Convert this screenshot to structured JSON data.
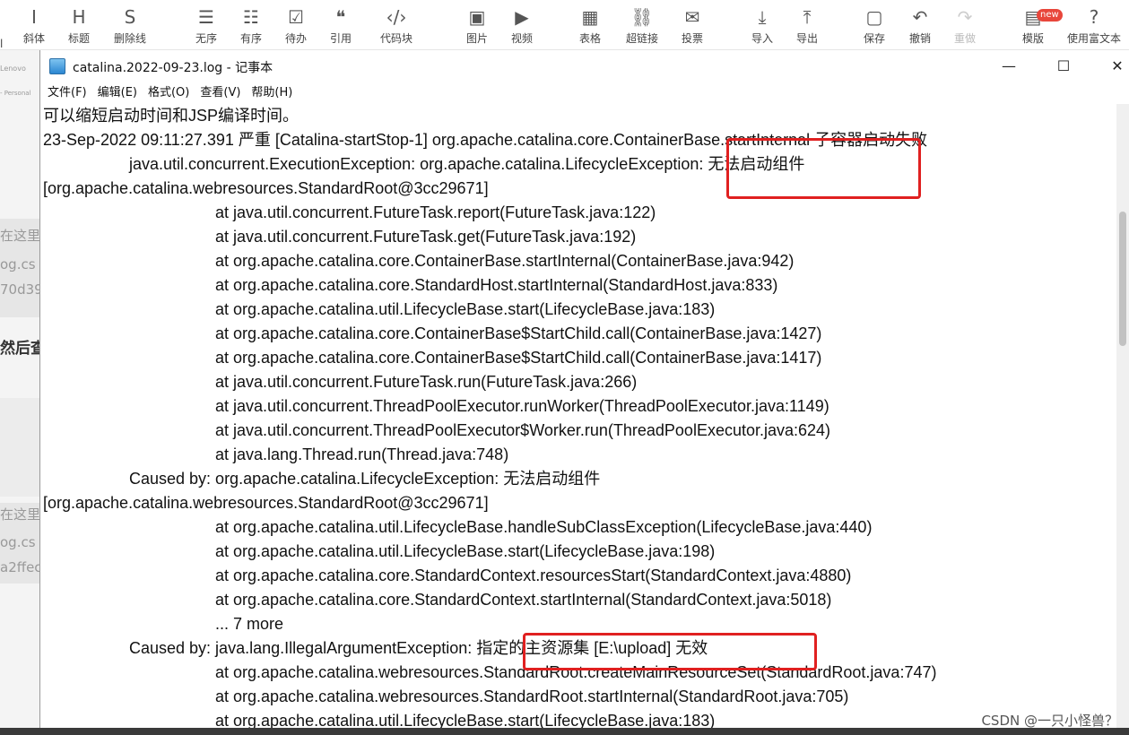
{
  "toolbar": {
    "items": [
      {
        "icon": "I",
        "label": "斜体",
        "name": "italic"
      },
      {
        "icon": "H",
        "label": "标题",
        "name": "heading"
      },
      {
        "icon": "S",
        "label": "删除线",
        "name": "strikethrough"
      },
      {
        "icon": "☰",
        "label": "无序",
        "name": "unordered-list"
      },
      {
        "icon": "☷",
        "label": "有序",
        "name": "ordered-list"
      },
      {
        "icon": "☑",
        "label": "待办",
        "name": "todo"
      },
      {
        "icon": "❝",
        "label": "引用",
        "name": "quote"
      },
      {
        "icon": "‹/›",
        "label": "代码块",
        "name": "code-block"
      },
      {
        "icon": "▣",
        "label": "图片",
        "name": "image"
      },
      {
        "icon": "▶",
        "label": "视频",
        "name": "video"
      },
      {
        "icon": "▦",
        "label": "表格",
        "name": "table"
      },
      {
        "icon": "⛓",
        "label": "超链接",
        "name": "hyperlink"
      },
      {
        "icon": "✉",
        "label": "投票",
        "name": "vote"
      },
      {
        "icon": "⤓",
        "label": "导入",
        "name": "import"
      },
      {
        "icon": "⤒",
        "label": "导出",
        "name": "export"
      },
      {
        "icon": "▢",
        "label": "保存",
        "name": "save"
      },
      {
        "icon": "↶",
        "label": "撤销",
        "name": "undo"
      },
      {
        "icon": "↷",
        "label": "重做",
        "name": "redo"
      },
      {
        "icon": "▤",
        "label": "模版",
        "name": "template"
      },
      {
        "icon": "?",
        "label": "使用富文本",
        "name": "use-rich-text"
      }
    ],
    "new_badge": "new",
    "left_partial_label": "l"
  },
  "background": {
    "snippets": [
      "Lenovo",
      "- Personal",
      "在这里",
      "og.cs",
      "70d39",
      "然后查",
      "在这里",
      "og.cs",
      "a2ffec"
    ]
  },
  "window": {
    "title": "catalina.2022-09-23.log - 记事本",
    "controls": {
      "minimize": "—",
      "maximize": "☐",
      "close": "✕"
    },
    "menu": [
      "文件(F)",
      "编辑(E)",
      "格式(O)",
      "查看(V)",
      "帮助(H)"
    ]
  },
  "log_lines": [
    {
      "indent": 0,
      "text": "可以缩短启动时间和JSP编译时间。"
    },
    {
      "indent": 0,
      "text": "23-Sep-2022 09:11:27.391 严重 [Catalina-startStop-1] org.apache.catalina.core.ContainerBase.startInternal 子容器启动失败"
    },
    {
      "indent": 1,
      "text": "java.util.concurrent.ExecutionException: org.apache.catalina.LifecycleException: 无法启动组件"
    },
    {
      "indent": 0,
      "text": "[org.apache.catalina.webresources.StandardRoot@3cc29671]"
    },
    {
      "indent": 2,
      "text": "at java.util.concurrent.FutureTask.report(FutureTask.java:122)"
    },
    {
      "indent": 2,
      "text": "at java.util.concurrent.FutureTask.get(FutureTask.java:192)"
    },
    {
      "indent": 2,
      "text": "at org.apache.catalina.core.ContainerBase.startInternal(ContainerBase.java:942)"
    },
    {
      "indent": 2,
      "text": "at org.apache.catalina.core.StandardHost.startInternal(StandardHost.java:833)"
    },
    {
      "indent": 2,
      "text": "at org.apache.catalina.util.LifecycleBase.start(LifecycleBase.java:183)"
    },
    {
      "indent": 2,
      "text": "at org.apache.catalina.core.ContainerBase$StartChild.call(ContainerBase.java:1427)"
    },
    {
      "indent": 2,
      "text": "at org.apache.catalina.core.ContainerBase$StartChild.call(ContainerBase.java:1417)"
    },
    {
      "indent": 2,
      "text": "at java.util.concurrent.FutureTask.run(FutureTask.java:266)"
    },
    {
      "indent": 2,
      "text": "at java.util.concurrent.ThreadPoolExecutor.runWorker(ThreadPoolExecutor.java:1149)"
    },
    {
      "indent": 2,
      "text": "at java.util.concurrent.ThreadPoolExecutor$Worker.run(ThreadPoolExecutor.java:624)"
    },
    {
      "indent": 2,
      "text": "at java.lang.Thread.run(Thread.java:748)"
    },
    {
      "indent": 1,
      "text": "Caused by: org.apache.catalina.LifecycleException: 无法启动组件"
    },
    {
      "indent": 0,
      "text": "[org.apache.catalina.webresources.StandardRoot@3cc29671]"
    },
    {
      "indent": 2,
      "text": "at org.apache.catalina.util.LifecycleBase.handleSubClassException(LifecycleBase.java:440)"
    },
    {
      "indent": 2,
      "text": "at org.apache.catalina.util.LifecycleBase.start(LifecycleBase.java:198)"
    },
    {
      "indent": 2,
      "text": "at org.apache.catalina.core.StandardContext.resourcesStart(StandardContext.java:4880)"
    },
    {
      "indent": 2,
      "text": "at org.apache.catalina.core.StandardContext.startInternal(StandardContext.java:5018)"
    },
    {
      "indent": 2,
      "text": "... 7 more"
    },
    {
      "indent": 1,
      "text": "Caused by: java.lang.IllegalArgumentException: 指定的主资源集 [E:\\upload] 无效"
    },
    {
      "indent": 2,
      "text": "at org.apache.catalina.webresources.StandardRoot.createMainResourceSet(StandardRoot.java:747)"
    },
    {
      "indent": 2,
      "text": "at org.apache.catalina.webresources.StandardRoot.startInternal(StandardRoot.java:705)"
    },
    {
      "indent": 2,
      "text": "at org.apache.catalina.util.LifecycleBase.start(LifecycleBase.java:183)"
    }
  ],
  "watermark": "CSDN @一只小怪兽？",
  "colors": {
    "highlight": "#e02020"
  }
}
